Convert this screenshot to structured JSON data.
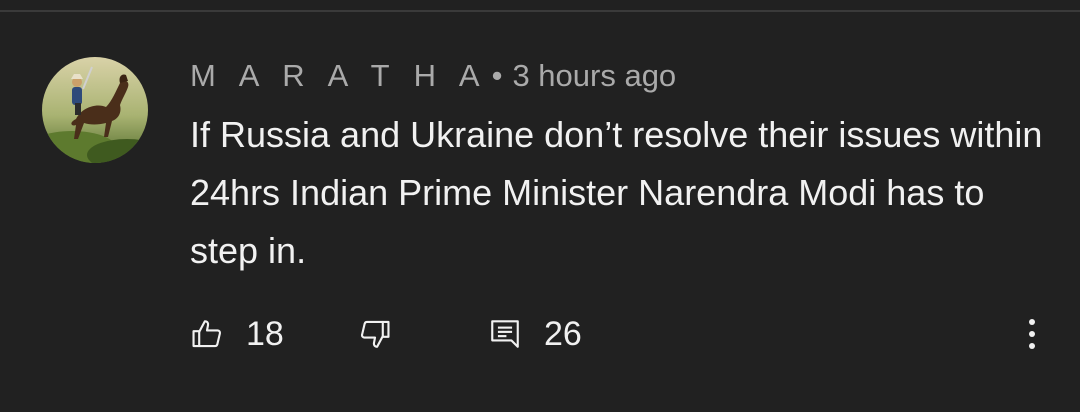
{
  "comment": {
    "author": "M A R A T H A",
    "separator": "•",
    "time": "3 hours ago",
    "text": "If Russia and Ukraine don’t resolve their issues within 24hrs Indian Prime Minister Narendra Modi has to step in.",
    "avatar_icon": "horse-rider-avatar"
  },
  "actions": {
    "like_icon": "thumbs-up-icon",
    "like_count": "18",
    "dislike_icon": "thumbs-down-icon",
    "reply_icon": "reply-comment-icon",
    "reply_count": "26",
    "more_icon": "more-vertical-icon"
  },
  "colors": {
    "background": "#212121",
    "primary_text": "#f1f1f1",
    "secondary_text": "#aaaaaa"
  }
}
